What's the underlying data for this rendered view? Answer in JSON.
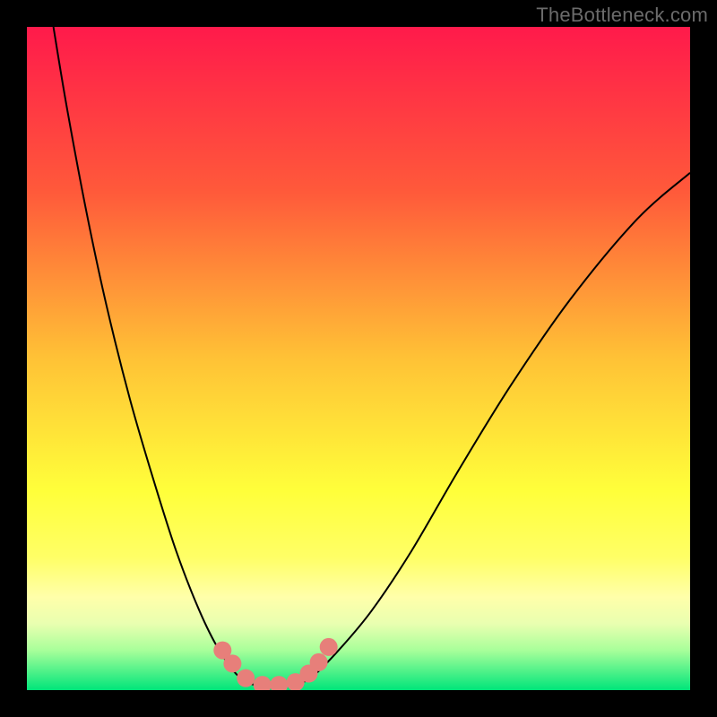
{
  "watermark": "TheBottleneck.com",
  "chart_data": {
    "type": "line",
    "title": "",
    "xlabel": "",
    "ylabel": "",
    "xlim": [
      0,
      100
    ],
    "ylim": [
      0,
      100
    ],
    "grid": false,
    "legend": false,
    "background_gradient": {
      "stops": [
        {
          "offset": 0.0,
          "color": "#ff1a4b"
        },
        {
          "offset": 0.25,
          "color": "#ff5a3a"
        },
        {
          "offset": 0.5,
          "color": "#ffc236"
        },
        {
          "offset": 0.7,
          "color": "#ffff3a"
        },
        {
          "offset": 0.8,
          "color": "#ffff66"
        },
        {
          "offset": 0.86,
          "color": "#ffffaa"
        },
        {
          "offset": 0.9,
          "color": "#e9ffb0"
        },
        {
          "offset": 0.94,
          "color": "#a8ff9a"
        },
        {
          "offset": 1.0,
          "color": "#00e57a"
        }
      ]
    },
    "series": [
      {
        "name": "left-curve",
        "style": {
          "stroke": "#000000",
          "stroke_width": 2
        },
        "points": [
          {
            "x": 4.0,
            "y": 100.0
          },
          {
            "x": 6.0,
            "y": 88.0
          },
          {
            "x": 9.0,
            "y": 72.0
          },
          {
            "x": 12.0,
            "y": 58.0
          },
          {
            "x": 15.5,
            "y": 44.0
          },
          {
            "x": 19.0,
            "y": 32.0
          },
          {
            "x": 22.5,
            "y": 21.0
          },
          {
            "x": 26.0,
            "y": 12.0
          },
          {
            "x": 29.0,
            "y": 6.0
          },
          {
            "x": 32.0,
            "y": 2.0
          },
          {
            "x": 35.0,
            "y": 0.5
          }
        ]
      },
      {
        "name": "right-curve",
        "style": {
          "stroke": "#000000",
          "stroke_width": 2
        },
        "points": [
          {
            "x": 40.0,
            "y": 0.5
          },
          {
            "x": 43.0,
            "y": 2.0
          },
          {
            "x": 47.0,
            "y": 6.0
          },
          {
            "x": 52.0,
            "y": 12.0
          },
          {
            "x": 58.0,
            "y": 21.0
          },
          {
            "x": 65.0,
            "y": 33.0
          },
          {
            "x": 73.0,
            "y": 46.0
          },
          {
            "x": 82.0,
            "y": 59.0
          },
          {
            "x": 92.0,
            "y": 71.0
          },
          {
            "x": 100.0,
            "y": 78.0
          }
        ]
      },
      {
        "name": "pink-dots",
        "style": {
          "fill": "#e77f7a",
          "radius": 10
        },
        "points": [
          {
            "x": 29.5,
            "y": 6.0
          },
          {
            "x": 31.0,
            "y": 4.0
          },
          {
            "x": 33.0,
            "y": 1.8
          },
          {
            "x": 35.5,
            "y": 0.8
          },
          {
            "x": 38.0,
            "y": 0.8
          },
          {
            "x": 40.5,
            "y": 1.2
          },
          {
            "x": 42.5,
            "y": 2.5
          },
          {
            "x": 44.0,
            "y": 4.2
          },
          {
            "x": 45.5,
            "y": 6.5
          }
        ]
      }
    ]
  }
}
